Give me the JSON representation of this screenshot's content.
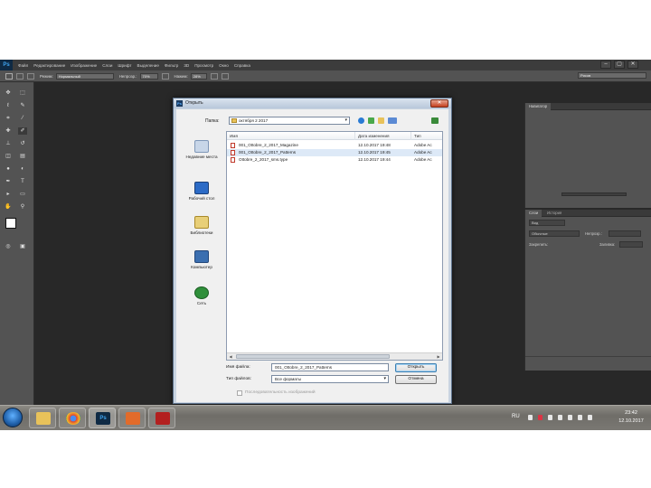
{
  "colors": {
    "workspace": "#282828",
    "panel": "#535353",
    "menubar": "#3c3c3c",
    "dialog_frame": "#c9d4e1",
    "dialog_body": "#f0f0f0",
    "selection": "#dde9f7",
    "close_button": "#c4401f"
  },
  "photoshop": {
    "logo": "Ps",
    "menu": [
      "Файл",
      "Редактирование",
      "Изображение",
      "Слои",
      "Шрифт",
      "Выделение",
      "Фильтр",
      "3D",
      "Просмотр",
      "Окно",
      "Справка"
    ],
    "window_controls": [
      "–",
      "▢",
      "✕"
    ],
    "options": {
      "mode_label": "Режим:",
      "mode_value": "Нормальный",
      "opacity_label": "Непрозр.:",
      "opacity_value": "70%",
      "flow_label": "Нажим:",
      "flow_value": "28%",
      "workspace_value": "Рисов"
    },
    "panels": {
      "navigator_tab": "Навигатор",
      "layers_tab": "Слои",
      "history_tab": "История",
      "kind_filter": "Вид",
      "blend_mode": "Обычные",
      "opacity_short": "Непрозр.:",
      "lock_label": "Закрепить:",
      "fill_label": "Заливка:"
    }
  },
  "dialog": {
    "title": "Открыть",
    "title_icon": "Ps",
    "close": "✕",
    "look_in_label": "Папка:",
    "look_in_value": "октября 2 2017",
    "places": [
      {
        "label": "Недавние места",
        "icon": "recent-places-icon"
      },
      {
        "label": "Рабочий стол",
        "icon": "desktop-icon"
      },
      {
        "label": "Библиотеки",
        "icon": "libraries-icon"
      },
      {
        "label": "Компьютер",
        "icon": "computer-icon"
      },
      {
        "label": "Сеть",
        "icon": "network-icon"
      }
    ],
    "columns": [
      "Имя",
      "Дата изменения",
      "Тип"
    ],
    "files": [
      {
        "name": "001_Ottobre_2_2017_Magazine",
        "date": "12.10.2017 19:48",
        "type": "Adobe Ac",
        "selected": false
      },
      {
        "name": "001_Ottobre_2_2017_Patterns",
        "date": "12.10.2017 19:45",
        "type": "Adobe Ac",
        "selected": true
      },
      {
        "name": "Ottobre_2_2017_sms.type",
        "date": "12.10.2017 19:44",
        "type": "Adobe Ac",
        "selected": false
      }
    ],
    "filename_label": "Имя файла:",
    "filename_value": "001_Ottobre_2_2017_Patterns",
    "filetype_label": "Тип файлов:",
    "filetype_value": "Все форматы",
    "open_button": "Открыть",
    "cancel_button": "Отмена",
    "preview_label": "Последовательность изображений"
  },
  "taskbar": {
    "apps": [
      {
        "name": "explorer",
        "label": ""
      },
      {
        "name": "chrome",
        "label": ""
      },
      {
        "name": "photoshop",
        "label": "Ps"
      },
      {
        "name": "photo-viewer",
        "label": ""
      },
      {
        "name": "acrobat",
        "label": ""
      }
    ],
    "lang": "RU",
    "time": "23:42",
    "date": "12.10.2017"
  }
}
